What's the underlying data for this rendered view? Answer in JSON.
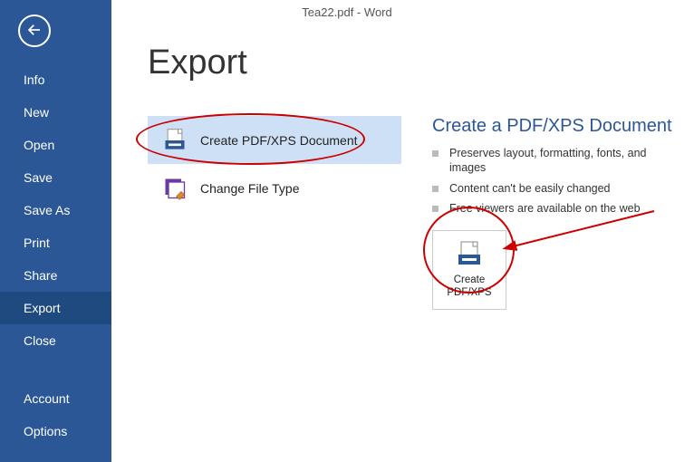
{
  "titlebar": "Tea22.pdf - Word",
  "sidebar": {
    "items": [
      {
        "label": "Info",
        "name": "sidebar-item-info"
      },
      {
        "label": "New",
        "name": "sidebar-item-new"
      },
      {
        "label": "Open",
        "name": "sidebar-item-open"
      },
      {
        "label": "Save",
        "name": "sidebar-item-save"
      },
      {
        "label": "Save As",
        "name": "sidebar-item-save-as"
      },
      {
        "label": "Print",
        "name": "sidebar-item-print"
      },
      {
        "label": "Share",
        "name": "sidebar-item-share"
      },
      {
        "label": "Export",
        "name": "sidebar-item-export"
      },
      {
        "label": "Close",
        "name": "sidebar-item-close"
      },
      {
        "label": "Account",
        "name": "sidebar-item-account"
      },
      {
        "label": "Options",
        "name": "sidebar-item-options"
      }
    ],
    "active_index": 7
  },
  "page": {
    "title": "Export"
  },
  "options": [
    {
      "label": "Create PDF/XPS Document",
      "icon": "pdf-xps-icon",
      "name": "option-create-pdf-xps",
      "selected": true
    },
    {
      "label": "Change File Type",
      "icon": "change-file-type-icon",
      "name": "option-change-file-type",
      "selected": false
    }
  ],
  "detail": {
    "title": "Create a PDF/XPS Document",
    "bullets": [
      "Preserves layout, formatting, fonts, and images",
      "Content can't be easily changed",
      "Free viewers are available on the web"
    ],
    "button": {
      "label": "Create\nPDF/XPS",
      "icon": "pdf-xps-icon"
    }
  },
  "annotation": {
    "ellipse1": true,
    "ellipse2": true,
    "arrow": true,
    "color": "#cc0000"
  }
}
